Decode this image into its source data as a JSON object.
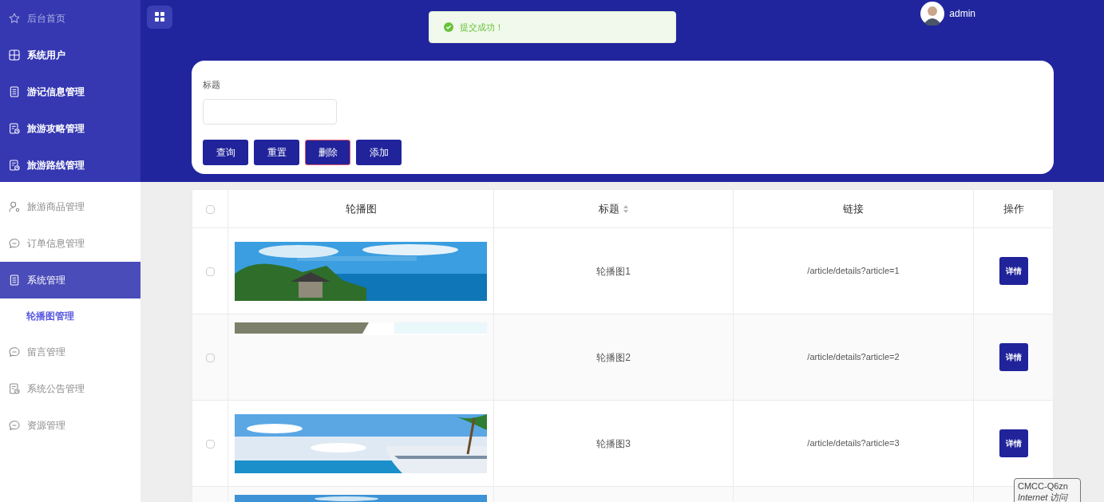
{
  "sidebar": {
    "items": [
      {
        "label": "后台首页",
        "kind": "primary",
        "selected": false,
        "muted": true
      },
      {
        "label": "系统用户",
        "kind": "primary",
        "selected": false,
        "muted": false
      },
      {
        "label": "游记信息管理",
        "kind": "primary",
        "selected": false,
        "muted": false
      },
      {
        "label": "旅游攻略管理",
        "kind": "primary",
        "selected": false,
        "muted": false
      },
      {
        "label": "旅游路线管理",
        "kind": "primary",
        "selected": false,
        "muted": false
      },
      {
        "label": "旅游商品管理",
        "kind": "secondary",
        "selected": false,
        "muted": false
      },
      {
        "label": "订单信息管理",
        "kind": "secondary",
        "selected": false,
        "muted": false
      },
      {
        "label": "系统管理",
        "kind": "secondary",
        "selected": true,
        "muted": false,
        "children": [
          {
            "label": "轮播图管理",
            "selected": true
          }
        ]
      },
      {
        "label": "留言管理",
        "kind": "secondary",
        "selected": false,
        "muted": false
      },
      {
        "label": "系统公告管理",
        "kind": "secondary",
        "selected": false,
        "muted": false
      },
      {
        "label": "资源管理",
        "kind": "secondary",
        "selected": false,
        "muted": false
      }
    ]
  },
  "header": {
    "user": "admin"
  },
  "toast": {
    "message": "提交成功！"
  },
  "search": {
    "label": "标题",
    "buttons": [
      {
        "label": "查询",
        "focused": false
      },
      {
        "label": "重置",
        "focused": false
      },
      {
        "label": "删除",
        "focused": true
      },
      {
        "label": "添加",
        "focused": false
      }
    ]
  },
  "table": {
    "all_checked": false,
    "columns": [
      {
        "label": "轮播图",
        "sortable": false
      },
      {
        "label": "标题",
        "sortable": true
      },
      {
        "label": "链接",
        "sortable": false
      },
      {
        "label": "操作",
        "sortable": false
      }
    ],
    "rows": [
      {
        "checked": false,
        "image": {
          "kind": "picture"
        },
        "title": "轮播图1",
        "link": "/article/details?article=1",
        "action": "详情"
      },
      {
        "checked": false,
        "image": {
          "kind": "picture"
        },
        "title": "轮播图2",
        "link": "/article/details?article=2",
        "action": "详情"
      },
      {
        "checked": false,
        "image": {
          "kind": "picture"
        },
        "title": "轮播图3",
        "link": "/article/details?article=3",
        "action": "详情"
      },
      {
        "image": {
          "kind": "picture"
        }
      }
    ]
  },
  "tooltip": {
    "lines": [
      "CMCC-Q6zn",
      "Internet 访问"
    ]
  }
}
